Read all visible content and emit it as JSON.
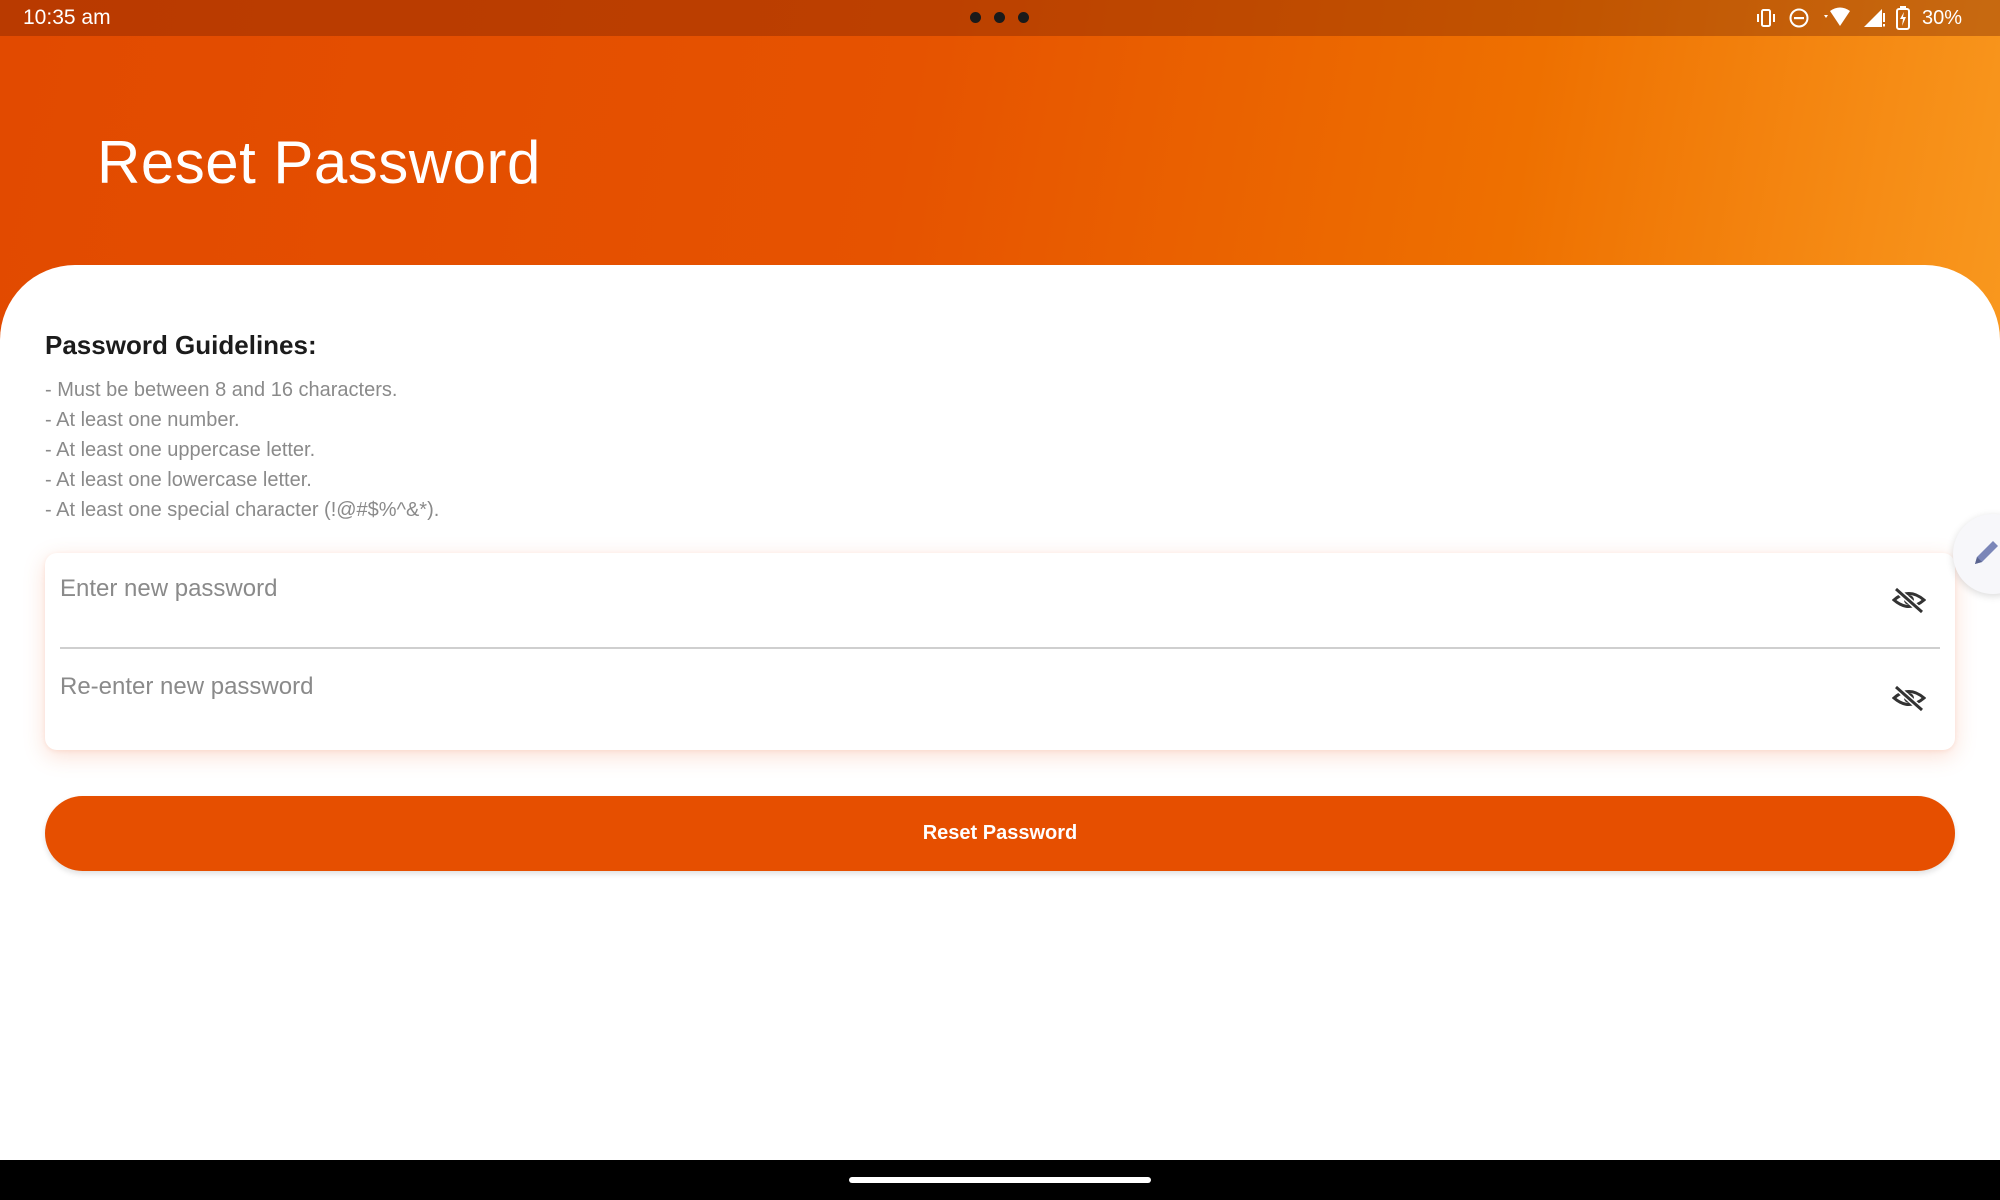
{
  "status_bar": {
    "time": "10:35 am",
    "battery": "30%",
    "icons": [
      "vibrate-icon",
      "do-not-disturb-icon",
      "wifi-icon",
      "signal-icon",
      "battery-icon"
    ]
  },
  "header": {
    "title": "Reset Password",
    "gradient_colors": [
      "#e24a00",
      "#e65300",
      "#ee7000",
      "#f9981e"
    ]
  },
  "guidelines": {
    "title": "Password Guidelines:",
    "items": [
      "- Must be between 8 and 16 characters.",
      "- At least one number.",
      "- At least one uppercase letter.",
      "- At least one lowercase letter.",
      "- At least one special character (!@#$%^&*)."
    ]
  },
  "form": {
    "new_password": {
      "value": "",
      "placeholder": "Enter new password"
    },
    "confirm_password": {
      "value": "",
      "placeholder": "Re-enter new password"
    }
  },
  "actions": {
    "submit_label": "Reset Password",
    "accent_color": "#e64f00"
  }
}
